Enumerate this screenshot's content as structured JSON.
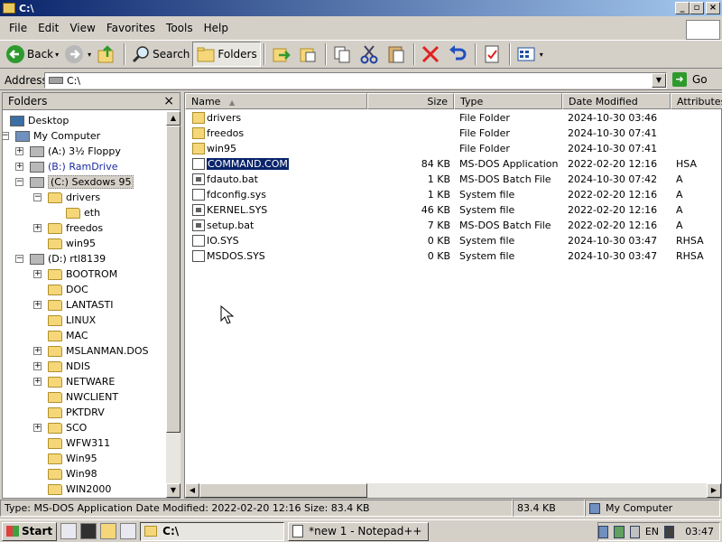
{
  "window": {
    "title": "C:\\",
    "controls": {
      "minimize": "_",
      "restore": "▫",
      "close": "×"
    }
  },
  "menu": [
    "File",
    "Edit",
    "View",
    "Favorites",
    "Tools",
    "Help"
  ],
  "toolbar": {
    "back": "Back",
    "search": "Search",
    "folders": "Folders"
  },
  "address": {
    "label": "Address",
    "value": "C:\\",
    "go": "Go"
  },
  "folders_pane": {
    "title": "Folders",
    "close": "×",
    "tree": [
      {
        "label": "Desktop",
        "icon": "desktop-icon"
      },
      {
        "label": "My Computer",
        "icon": "computer-icon",
        "toggle": "−"
      },
      {
        "label": "(A:) 3½ Floppy",
        "icon": "floppy-icon",
        "toggle": "+"
      },
      {
        "label": "(B:) RamDrive",
        "icon": "drive-icon",
        "toggle": "+"
      },
      {
        "label": "(C:) Sexdows 95",
        "icon": "drive-icon",
        "toggle": "−",
        "selected": true
      },
      {
        "label": "drivers",
        "icon": "folder-icon",
        "toggle": "−"
      },
      {
        "label": "eth",
        "icon": "folder-icon"
      },
      {
        "label": "freedos",
        "icon": "folder-icon",
        "toggle": "+"
      },
      {
        "label": "win95",
        "icon": "folder-icon"
      },
      {
        "label": "(D:) rtl8139",
        "icon": "cdrom-icon",
        "toggle": "−"
      },
      {
        "label": "BOOTROM",
        "icon": "folder-icon",
        "toggle": "+"
      },
      {
        "label": "DOC",
        "icon": "folder-icon"
      },
      {
        "label": "LANTASTI",
        "icon": "folder-icon",
        "toggle": "+"
      },
      {
        "label": "LINUX",
        "icon": "folder-icon"
      },
      {
        "label": "MAC",
        "icon": "folder-icon"
      },
      {
        "label": "MSLANMAN.DOS",
        "icon": "folder-icon",
        "toggle": "+"
      },
      {
        "label": "NDIS",
        "icon": "folder-icon",
        "toggle": "+"
      },
      {
        "label": "NETWARE",
        "icon": "folder-icon",
        "toggle": "+"
      },
      {
        "label": "NWCLIENT",
        "icon": "folder-icon"
      },
      {
        "label": "PKTDRV",
        "icon": "folder-icon"
      },
      {
        "label": "SCO",
        "icon": "folder-icon",
        "toggle": "+"
      },
      {
        "label": "WFW311",
        "icon": "folder-icon"
      },
      {
        "label": "Win95",
        "icon": "folder-icon"
      },
      {
        "label": "Win98",
        "icon": "folder-icon"
      },
      {
        "label": "WIN2000",
        "icon": "folder-icon"
      }
    ]
  },
  "columns": [
    "Name",
    "Size",
    "Type",
    "Date Modified",
    "Attributes"
  ],
  "files": [
    {
      "name": "drivers",
      "size": "",
      "type": "File Folder",
      "date": "2024-10-30 03:46",
      "attr": "",
      "icon": "folder"
    },
    {
      "name": "freedos",
      "size": "",
      "type": "File Folder",
      "date": "2024-10-30 07:41",
      "attr": "",
      "icon": "folder"
    },
    {
      "name": "win95",
      "size": "",
      "type": "File Folder",
      "date": "2024-10-30 07:41",
      "attr": "",
      "icon": "folder"
    },
    {
      "name": "COMMAND.COM",
      "size": "84 KB",
      "type": "MS-DOS Application",
      "date": "2022-02-20 12:16",
      "attr": "HSA",
      "icon": "file",
      "selected": true
    },
    {
      "name": "fdauto.bat",
      "size": "1 KB",
      "type": "MS-DOS Batch File",
      "date": "2024-10-30 07:42",
      "attr": "A",
      "icon": "batch"
    },
    {
      "name": "fdconfig.sys",
      "size": "1 KB",
      "type": "System file",
      "date": "2022-02-20 12:16",
      "attr": "A",
      "icon": "file"
    },
    {
      "name": "KERNEL.SYS",
      "size": "46 KB",
      "type": "System file",
      "date": "2022-02-20 12:16",
      "attr": "A",
      "icon": "batch"
    },
    {
      "name": "setup.bat",
      "size": "7 KB",
      "type": "MS-DOS Batch File",
      "date": "2022-02-20 12:16",
      "attr": "A",
      "icon": "batch"
    },
    {
      "name": "IO.SYS",
      "size": "0 KB",
      "type": "System file",
      "date": "2024-10-30 03:47",
      "attr": "RHSA",
      "icon": "file"
    },
    {
      "name": "MSDOS.SYS",
      "size": "0 KB",
      "type": "System file",
      "date": "2024-10-30 03:47",
      "attr": "RHSA",
      "icon": "file"
    }
  ],
  "status": {
    "info": "Type: MS-DOS Application Date Modified: 2022-02-20 12:16 Size: 83.4 KB",
    "size": "83.4 KB",
    "zone": "My Computer"
  },
  "taskbar": {
    "start": "Start",
    "tasks": [
      "C:\\",
      "*new 1 - Notepad++"
    ],
    "lang": "EN",
    "clock": "03:47"
  }
}
